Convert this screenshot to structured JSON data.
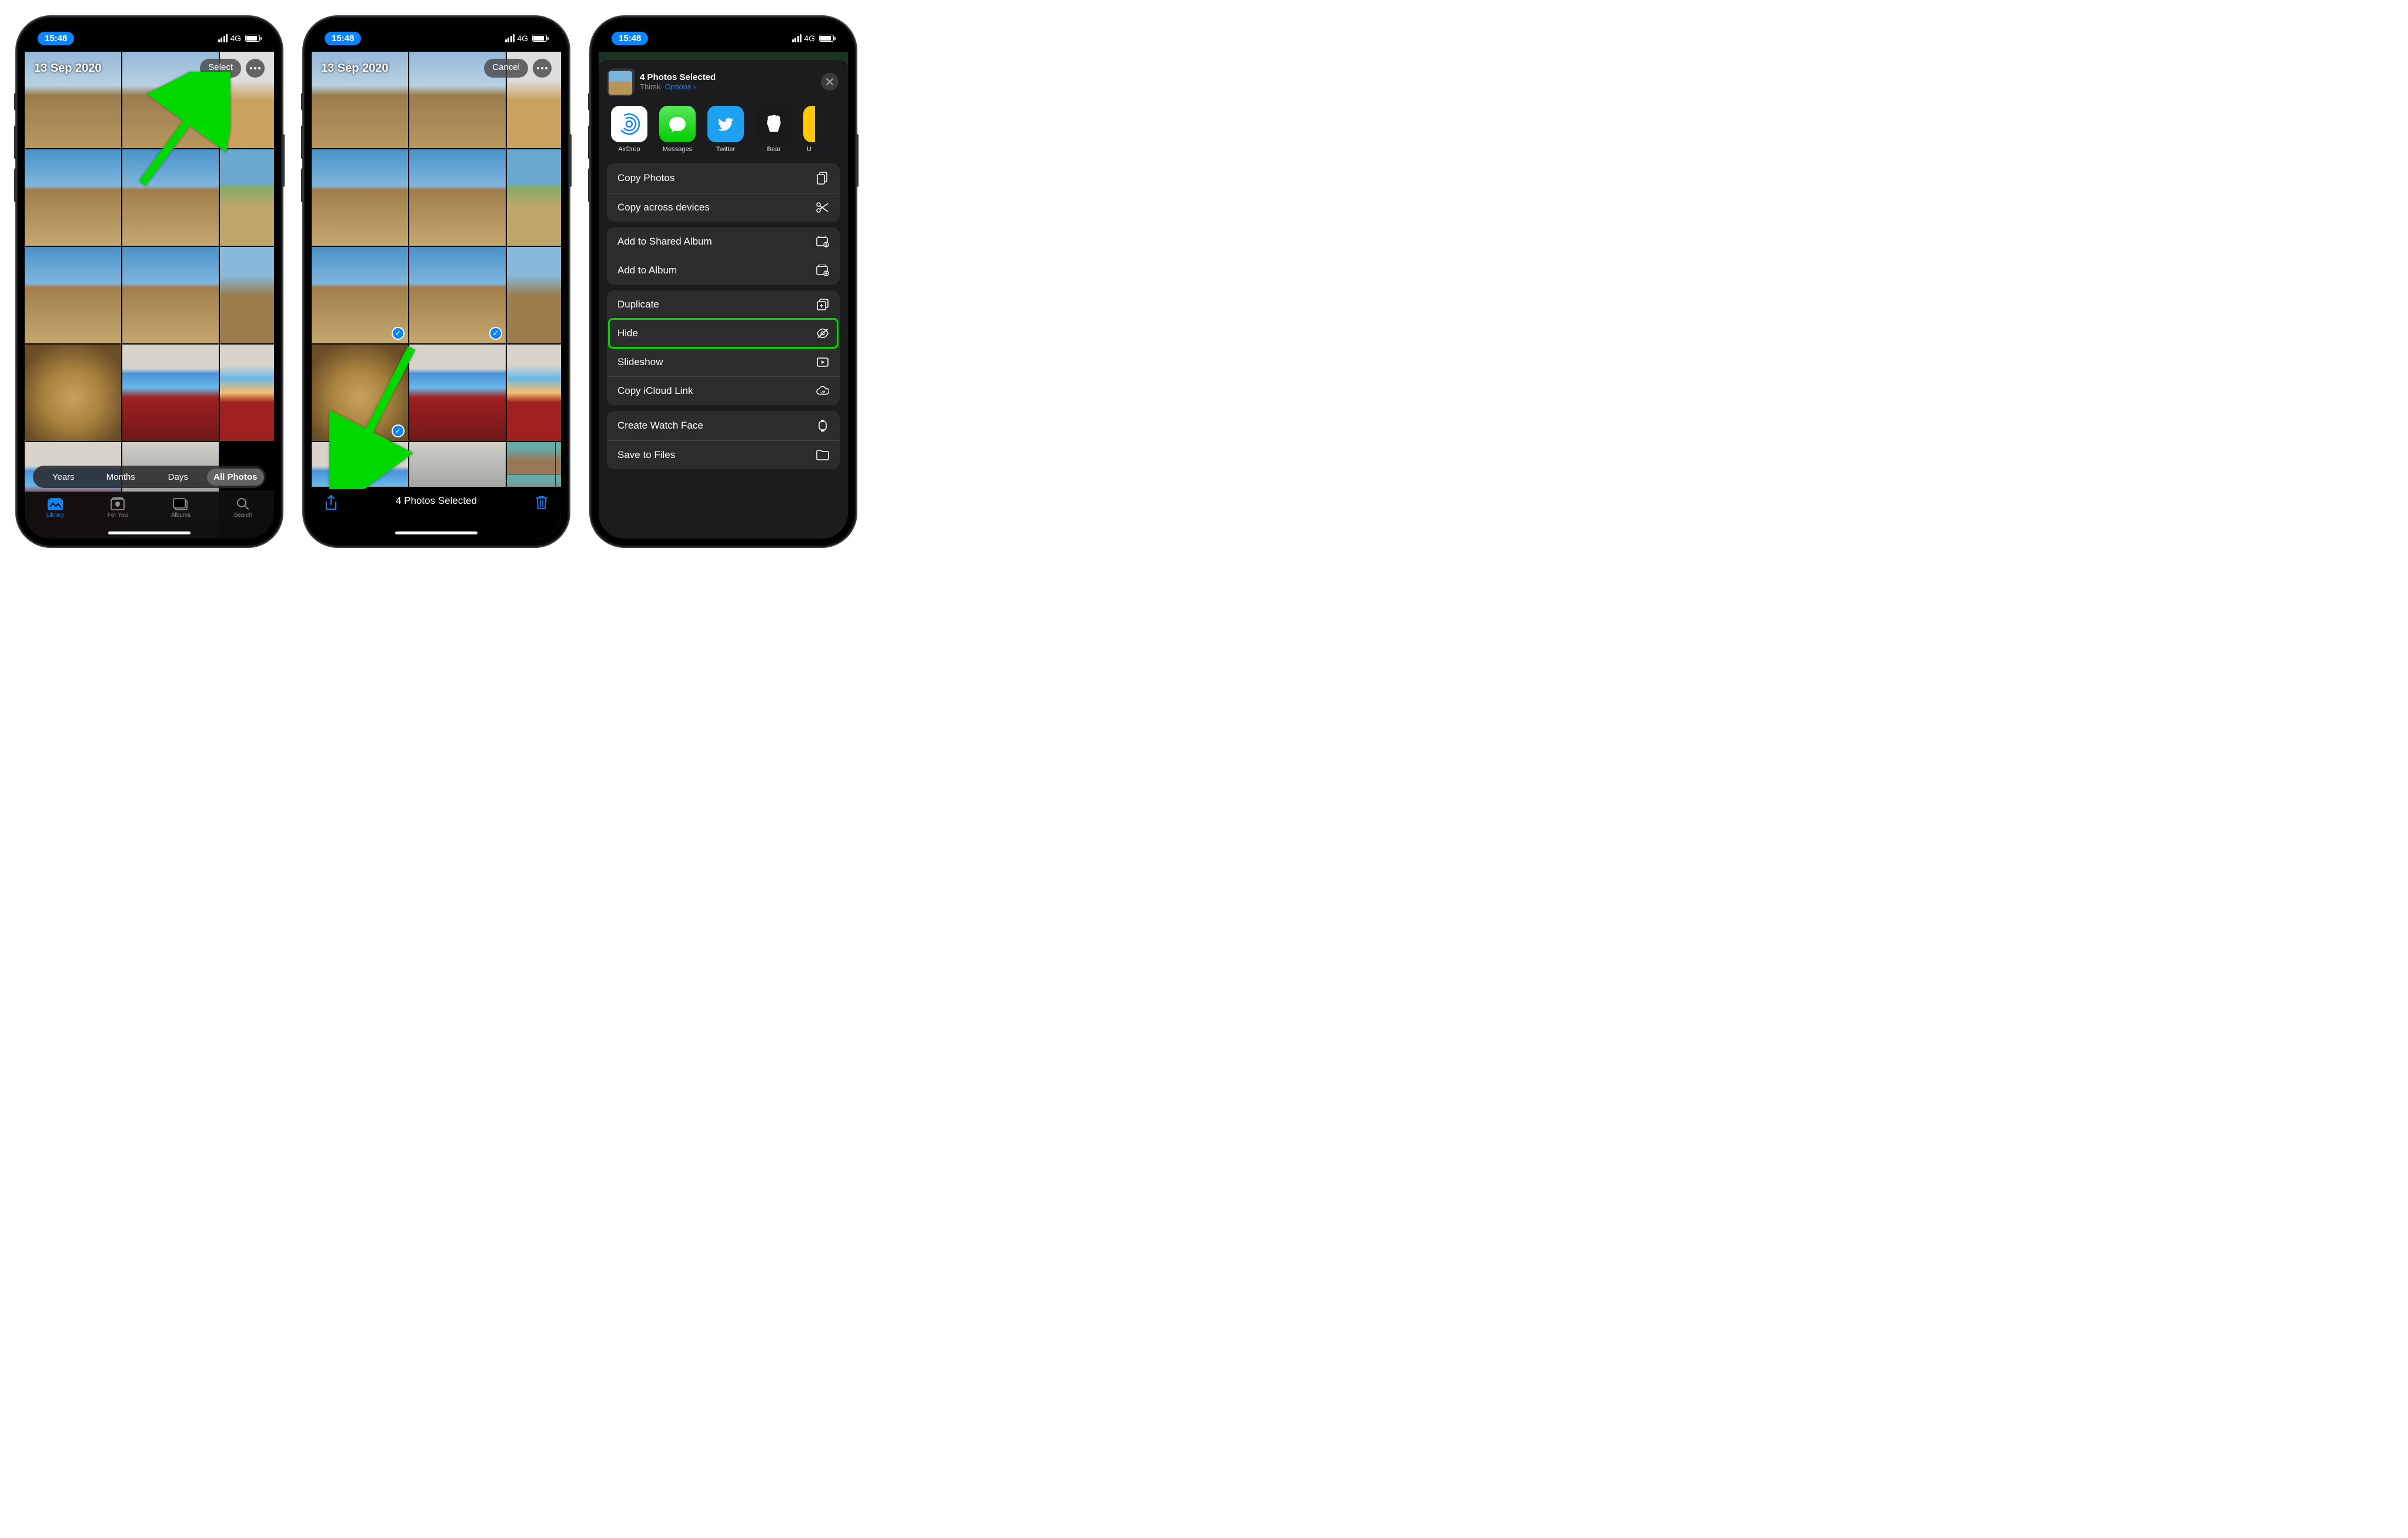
{
  "status": {
    "time": "15:48",
    "network": "4G"
  },
  "screen1": {
    "date_title": "13 Sep 2020",
    "select_label": "Select",
    "segments": [
      "Years",
      "Months",
      "Days",
      "All Photos"
    ],
    "active_segment": "All Photos",
    "tabs": [
      {
        "label": "Library",
        "icon": "library"
      },
      {
        "label": "For You",
        "icon": "foryou"
      },
      {
        "label": "Albums",
        "icon": "albums"
      },
      {
        "label": "Search",
        "icon": "search"
      }
    ],
    "active_tab": "Library"
  },
  "screen2": {
    "date_title": "13 Sep 2020",
    "cancel_label": "Cancel",
    "selection_label": "4 Photos Selected"
  },
  "screen3": {
    "sheet_title": "4 Photos Selected",
    "location": "Thirsk",
    "options_label": "Options",
    "apps": [
      {
        "label": "AirDrop",
        "kind": "airdrop"
      },
      {
        "label": "Messages",
        "kind": "messages"
      },
      {
        "label": "Twitter",
        "kind": "twitter"
      },
      {
        "label": "Bear",
        "kind": "bear"
      }
    ],
    "groups": [
      [
        {
          "label": "Copy Photos",
          "icon": "copy"
        },
        {
          "label": "Copy across devices",
          "icon": "scissors"
        }
      ],
      [
        {
          "label": "Add to Shared Album",
          "icon": "shared-album"
        },
        {
          "label": "Add to Album",
          "icon": "album"
        }
      ],
      [
        {
          "label": "Duplicate",
          "icon": "duplicate"
        },
        {
          "label": "Hide",
          "icon": "hide",
          "highlighted": true
        },
        {
          "label": "Slideshow",
          "icon": "slideshow"
        },
        {
          "label": "Copy iCloud Link",
          "icon": "link"
        }
      ],
      [
        {
          "label": "Create Watch Face",
          "icon": "watch"
        },
        {
          "label": "Save to Files",
          "icon": "folder"
        }
      ]
    ]
  }
}
